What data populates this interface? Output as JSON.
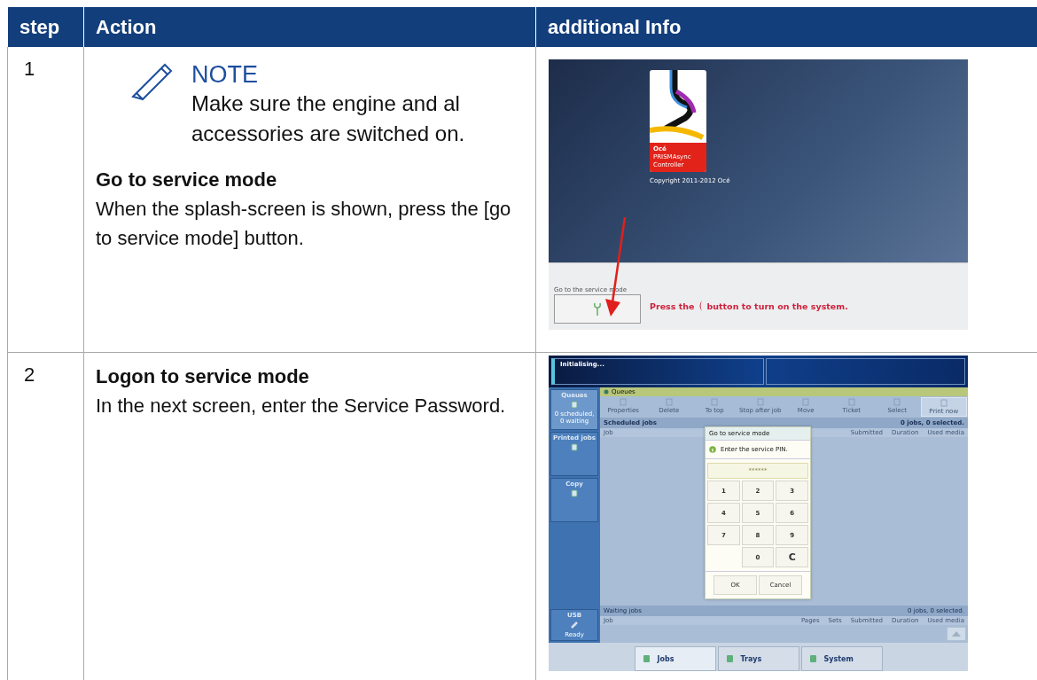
{
  "table": {
    "columns": [
      "step",
      "Action",
      "additional Info"
    ],
    "rows": [
      {
        "step": "1",
        "note": {
          "title": "NOTE",
          "text": "Make sure the engine and al accessories are switched on."
        },
        "heading": "Go to service mode",
        "text": "When the splash-screen is shown, press the [go to service mode] button.",
        "screen": {
          "kind": "splash",
          "logo_lines": [
            "Océ",
            "PRISMAsync",
            "Controller"
          ],
          "copyright": "Copyright 2011-2012 Océ",
          "service_label": "Go to the service mode",
          "message_before": "Press the",
          "message_after": "button to turn on the system."
        }
      },
      {
        "step": "2",
        "heading": "Logon to service mode",
        "text": "In the next screen, enter the Service Password.",
        "screen": {
          "kind": "pin",
          "status": "Initialising...",
          "sidebar": [
            {
              "label": "Queues",
              "sub": "0 scheduled, 0 waiting",
              "selected": true
            },
            {
              "label": "Printed jobs",
              "selected": false
            },
            {
              "label": "Copy",
              "selected": false
            }
          ],
          "usb": {
            "label": "USB",
            "sub": "Ready"
          },
          "header": "Queues",
          "toolbar": [
            "Properties",
            "Delete",
            "To top",
            "Stop after job",
            "Move",
            "Ticket",
            "Select",
            "Print now"
          ],
          "scheduled": {
            "title": "Scheduled jobs",
            "count": "0 jobs, 0 selected.",
            "columns": [
              "Job",
              "Submitted",
              "Duration",
              "Used media"
            ]
          },
          "waiting": {
            "title": "Waiting jobs",
            "count": "0 jobs, 0 selected.",
            "columns": [
              "Job",
              "Pages",
              "Sets",
              "Submitted",
              "Duration",
              "Used media"
            ]
          },
          "dialog": {
            "title": "Go to service mode",
            "message": "Enter the service PIN.",
            "value": "******",
            "keys": [
              "1",
              "2",
              "3",
              "4",
              "5",
              "6",
              "7",
              "8",
              "9",
              "0",
              "C"
            ],
            "buttons": [
              "OK",
              "Cancel"
            ]
          },
          "tabs": [
            {
              "label": "Jobs",
              "selected": true
            },
            {
              "label": "Trays",
              "selected": false
            },
            {
              "label": "System",
              "selected": false
            }
          ]
        }
      }
    ]
  }
}
